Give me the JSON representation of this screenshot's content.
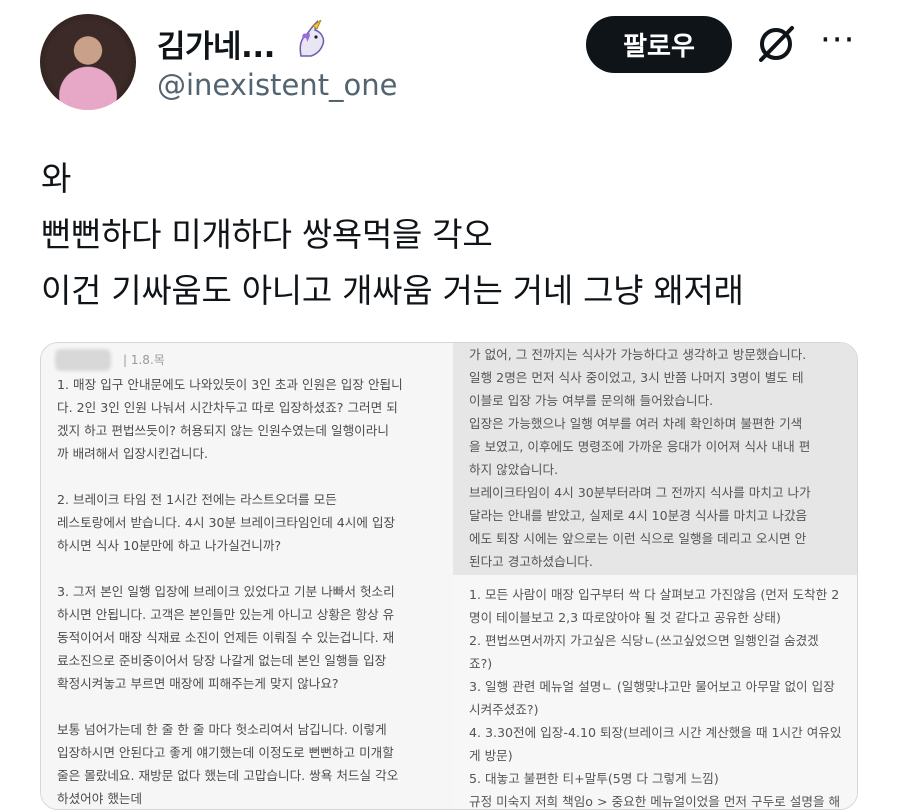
{
  "profile": {
    "display_name": "김가네...",
    "handle": "@inexistent_one",
    "follow_label": "팔로우",
    "icons": [
      "avatar",
      "unicorn-icon",
      "grok-icon",
      "more-icon"
    ]
  },
  "tweet": {
    "lines": [
      "와",
      "뻔뻔하다 미개하다 쌍욕먹을 각오",
      "이건 기싸움도 아니고 개싸움 거는 거네 그냥 왜저래"
    ]
  },
  "image": {
    "meta": "| 1.8.목",
    "left": [
      "1. 매장 입구 안내문에도 나와있듯이 3인 초과 인원은 입장 안됩니",
      "다. 2인 3인 인원 나눠서 시간차두고 따로 입장하셨죠? 그러면 되",
      "겠지 하고 편법쓰듯이? 허용되지 않는 인원수였는데 일행이라니",
      "까 배려해서 입장시킨겁니다.",
      "",
      "2. 브레이크 타임 전 1시간 전에는 라스트오더를 모든",
      "레스토랑에서 받습니다. 4시 30분 브레이크타임인데 4시에 입장",
      "하시면 식사 10분만에 하고 나가실건니까?",
      "",
      "3. 그저 본인 일행 입장에 브레이크 있었다고 기분 나빠서 헛소리",
      "하시면 안됩니다. 고객은 본인들만 있는게 아니고 상황은 항상 유",
      "동적이어서 매장 식재료 소진이 언제든 이뤄질 수 있는겁니다. 재",
      "료소진으로 준비중이어서 당장 나갈게 없는데 본인 일행들 입장",
      "확정시켜놓고 부르면 매장에 피해주는게 맞지 않나요?",
      "",
      "보통 넘어가는데 한 줄 한 줄 마다 헛소리여서 남깁니다. 이렇게",
      "입장하시면 안된다고 좋게 얘기했는데 이정도로 뻔뻔하고 미개할",
      "줄은 몰랐네요. 재방문 없다 했는데 고맙습니다. 쌍욕 처드실 각오",
      "하셨어야 했는데"
    ],
    "right_top": [
      "가 없어, 그 전까지는 식사가 가능하다고 생각하고 방문했습니다.",
      "일행 2명은 먼저 식사 중이었고, 3시 반쯤 나머지 3명이 별도 테",
      "이블로 입장 가능 여부를 문의해 들어왔습니다.",
      "입장은 가능했으나 일행 여부를 여러 차례 확인하며 불편한 기색",
      "을 보였고, 이후에도 명령조에 가까운 응대가 이어져 식사 내내 편",
      "하지 않았습니다.",
      "브레이크타임이 4시 30분부터라며 그 전까지 식사를 마치고 나가",
      "달라는 안내를 받았고, 실제로 4시 10분경 식사를 마치고 나갔음",
      "에도 퇴장 시에는 앞으로는 이런 식으로 일행을 데리고 오시면 안",
      "된다고 경고하셨습니다."
    ],
    "right_bottom": [
      "1. 모든 사람이 매장 입구부터 싹 다 살펴보고 가진않음 (먼저 도착한 2",
      "명이 테이블보고 2,3 따로앉아야 될 것 같다고 공유한 상태)",
      "2. 편법쓰면서까지 가고싶은 식당ㄴ(쓰고싶었으면 일행인걸 숨겼겠",
      "죠?)",
      "3. 일행 관련 메뉴얼 설명ㄴ (일행맞냐고만 물어보고 아무말 없이 입장",
      "시켜주셨죠?)",
      "4. 3.30전에 입장-4.10 퇴장(브레이크 시간 계산했을 때 1시간 여유있",
      "게 방문)",
      "5. 대놓고 불편한 티+말투(5명 다 그렇게 느낌)",
      "규정 미숙지 저희 책임o > 중요한 메뉴얼이었을 먼저 구두로 설명을 해"
    ]
  }
}
